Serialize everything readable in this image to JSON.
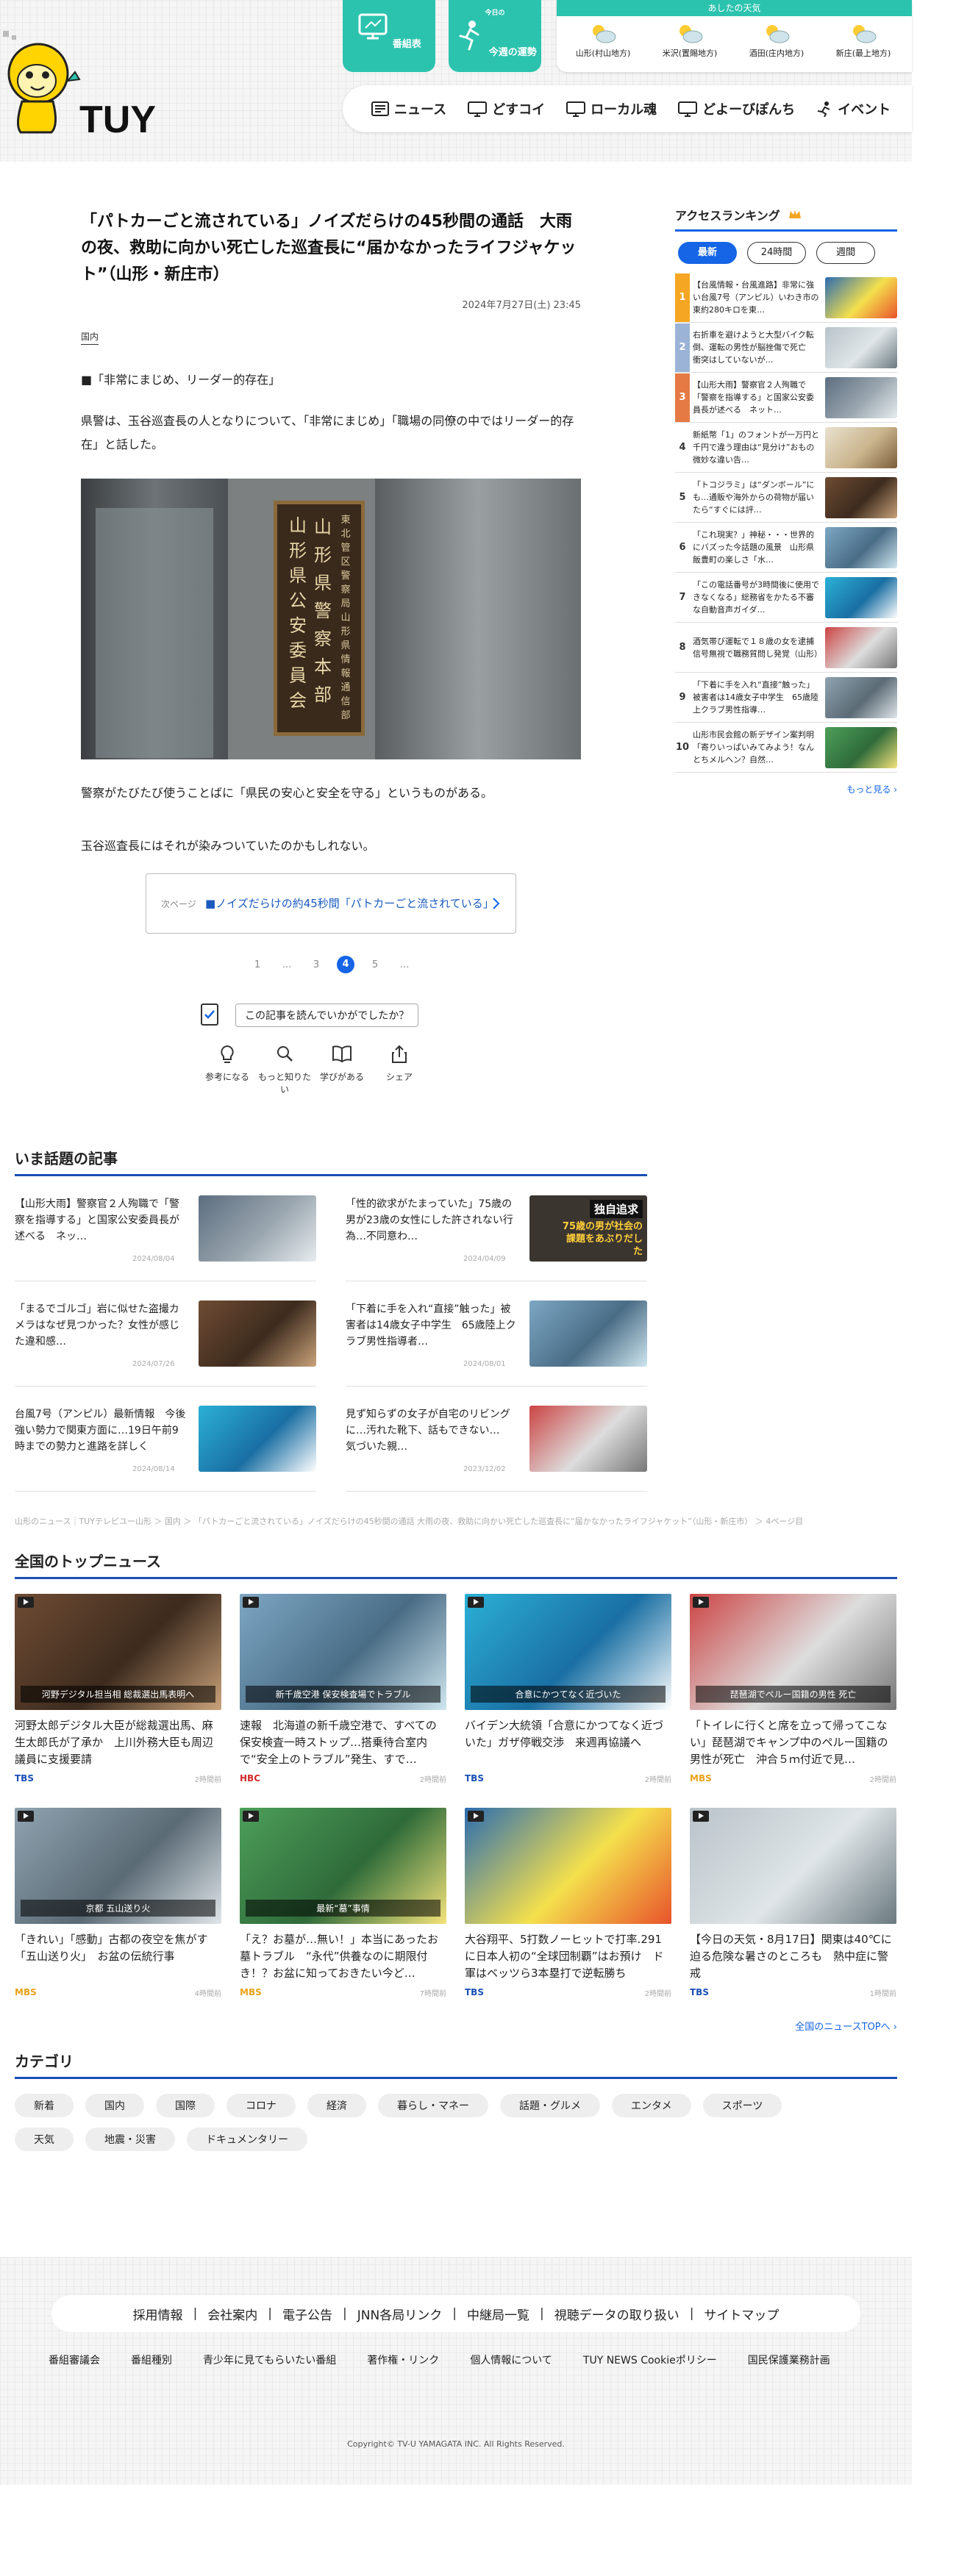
{
  "header": {
    "logo_text": "TUY",
    "btn_program": "番組表",
    "btn_fortune_small": "今日の",
    "btn_fortune": "今週の運勢",
    "weather_title": "あしたの天気",
    "weather": [
      {
        "area": "山形(村山地方)",
        "icon": "partly-sunny-icon"
      },
      {
        "area": "米沢(置賜地方)",
        "icon": "partly-sunny-icon"
      },
      {
        "area": "酒田(庄内地方)",
        "icon": "partly-sunny-icon"
      },
      {
        "area": "新庄(最上地方)",
        "icon": "partly-sunny-icon"
      }
    ],
    "nav": [
      "ニュース",
      "どすコイ",
      "ローカル魂",
      "どよーびぽんち",
      "イベント"
    ]
  },
  "article": {
    "title": "「パトカーごと流されている」ノイズだらけの45秒間の通話　大雨の夜、救助に向かい死亡した巡査長に“届かなかったライフジャケット”（山形・新庄市）",
    "date": "2024年7月27日(土) 23:45",
    "category": "国内",
    "subhead": "■「非常にまじめ、リーダー的存在」",
    "para1": "県警は、玉谷巡査長の人となりについて、「非常にまじめ」「職場の同僚の中ではリーダー的存在」と話した。",
    "sign_left": "山形県公安委員会",
    "sign_right": "山形県警察本部",
    "sign_small": "東北管区警察局山形県情報通信部",
    "para2": "警察がたびたび使うことばに「県民の安心と安全を守る」というものがある。",
    "para3": "玉谷巡査長にはそれが染みついていたのかもしれない。",
    "next_label": "次ページ",
    "next_title": "■ノイズだらけの約45秒間「パトカーごと流されている」",
    "pages": [
      "1",
      "…",
      "3",
      "4",
      "5",
      "…"
    ],
    "current_page": "4",
    "feedback_q": "この記事を読んでいかがでしたか？",
    "feedback_opts": [
      "参考になる",
      "もっと知りたい",
      "学びがある",
      "シェア"
    ]
  },
  "ranking": {
    "title": "アクセスランキング",
    "tabs": [
      "最新",
      "24時間",
      "週間"
    ],
    "items": [
      {
        "no": "1",
        "text": "【台風情報・台風進路】非常に強い台風7号（アンピル）いわき市の東約280キロを東…",
        "color": "#f5a623"
      },
      {
        "no": "2",
        "text": "右折車を避けようと大型バイク転倒、運転の男性が脳挫傷で死亡　衝突はしていないが…",
        "color": "#9ab3d6"
      },
      {
        "no": "3",
        "text": "【山形大雨】警察官２人殉職で「警察を指導する」と国家公安委員長が述べる　ネット…",
        "color": "#e57a44"
      },
      {
        "no": "4",
        "text": "新紙幣「1」のフォントが一万円と千円で違う理由は“見分け”おもの微妙な違い告…",
        "color": ""
      },
      {
        "no": "5",
        "text": "「トコジラミ」は“ダンボール”にも…通販や海外からの荷物が届いたら“すぐには評…",
        "color": ""
      },
      {
        "no": "6",
        "text": "「これ現実？」神秘・・・世界的にバズった今話題の風景　山形県飯豊町の楽しさ「水…",
        "color": ""
      },
      {
        "no": "7",
        "text": "「この電話番号が3時間後に使用できなくなる」総務省をかたる不審な自動音声ガイダ…",
        "color": ""
      },
      {
        "no": "8",
        "text": "酒気帯び運転で１８歳の女を逮捕　信号無視で職務質問し発覚（山形）",
        "color": ""
      },
      {
        "no": "9",
        "text": "「下着に手を入れ“直接”触った」被害者は14歳女子中学生　65歳陸上クラブ男性指導…",
        "color": ""
      },
      {
        "no": "10",
        "text": "山形市民会館の新デザイン案判明「寄りいっぱいみてみよう！なんとちメルヘン？自然…",
        "color": ""
      }
    ],
    "more": "もっと見る"
  },
  "trending": {
    "title": "いま話題の記事",
    "items": [
      {
        "text": "【山形大雨】警察官２人殉職で「警察を指導する」と国家公安委員長が述べる　ネッ…",
        "date": "2024/08/04"
      },
      {
        "text": "「性的欲求がたまっていた」75歳の男が23歳の女性にした許されない行為…不同意わ…",
        "date": "2024/04/09",
        "badge": "独自追求",
        "badge2": "75歳の男が社会の課題をあぶりだした"
      },
      {
        "text": "「まるでゴルゴ」岩に似せた盗撮カメラはなぜ見つかった？女性が感じた違和感…",
        "date": "2024/07/26"
      },
      {
        "text": "「下着に手を入れ“直接”触った」被害者は14歳女子中学生　65歳陸上クラブ男性指導者…",
        "date": "2024/08/01"
      },
      {
        "text": "台風7号（アンピル）最新情報　今後強い勢力で関東方面に…19日午前9時までの勢力と進路を詳しく",
        "date": "2024/08/14"
      },
      {
        "text": "見ず知らずの女子が自宅のリビングに…汚れた靴下、話もできない…　気づいた親…",
        "date": "2023/12/02"
      }
    ]
  },
  "breadcrumb": "山形のニュース｜TUYテレビユー山形 ＞ 国内 ＞ 「パトカーごと流されている」ノイズだらけの45秒間の通話 大雨の夜、救助に向かい死亡した巡査長に“届かなかったライフジャケット”（山形・新庄市） ＞ 4ページ目",
  "national": {
    "title": "全国のトップニュース",
    "items": [
      {
        "text": "河野太郎デジタル大臣が総裁選出馬、麻生太郎氏が了承か　上川外務大臣も周辺議員に支援要請",
        "src": "TBS",
        "src_color": "#1a4fb5",
        "time": "2時間前",
        "cap": "河野デジタル担当相 総裁選出馬表明へ"
      },
      {
        "text": "速報　北海道の新千歳空港で、すべての保安検査一時ストップ…搭乗待合室内で“安全上のトラブル”発生、すで…",
        "src": "HBC",
        "src_color": "#d12a2a",
        "time": "2時間前",
        "cap": "新千歳空港 保安検査場でトラブル"
      },
      {
        "text": "バイデン大統領「合意にかつてなく近づいた」ガザ停戦交渉　来週再協議へ",
        "src": "TBS",
        "src_color": "#1a4fb5",
        "time": "2時間前",
        "cap": "合意にかつてなく近づいた"
      },
      {
        "text": "「トイレに行くと席を立って帰ってこない」琵琶湖でキャンプ中のペルー国籍の男性が死亡　沖合５ｍ付近で見…",
        "src": "MBS",
        "src_color": "#e8a21a",
        "time": "2時間前",
        "cap": "琵琶湖でペルー国籍の男性 死亡"
      },
      {
        "text": "「きれい」「感動」古都の夜空を焦がす「五山送り火」　お盆の伝統行事",
        "src": "MBS",
        "src_color": "#e8a21a",
        "time": "4時間前",
        "cap": "京都 五山送り火"
      },
      {
        "text": "「え？お墓が…無い！」本当にあったお墓トラブル　“永代”供養なのに期限付き！？お盆に知っておきたい今ど…",
        "src": "MBS",
        "src_color": "#e8a21a",
        "time": "7時間前",
        "cap": "最新“墓”事情"
      },
      {
        "text": "大谷翔平、5打数ノーヒットで打率.291に日本人初の“全球団制覇”はお預け　ド軍はベッツら3本塁打で逆転勝ち",
        "src": "TBS",
        "src_color": "#1a4fb5",
        "time": "2時間前",
        "cap": ""
      },
      {
        "text": "【今日の天気・8月17日】関東は40℃に迫る危険な暑さのところも　熱中症に警戒",
        "src": "TBS",
        "src_color": "#1a4fb5",
        "time": "1時間前",
        "cap": ""
      }
    ],
    "more": "全国のニュースTOPへ"
  },
  "categories": {
    "title": "カテゴリ",
    "items": [
      "新着",
      "国内",
      "国際",
      "コロナ",
      "経済",
      "暮らし・マネー",
      "話題・グルメ",
      "エンタメ",
      "スポーツ",
      "天気",
      "地震・災害",
      "ドキュメンタリー"
    ]
  },
  "footer": {
    "links": [
      "採用情報",
      "会社案内",
      "電子公告",
      "JNN各局リンク",
      "中継局一覧",
      "視聴データの取り扱い",
      "サイトマップ"
    ],
    "links2": [
      "番組審議会",
      "番組種別",
      "青少年に見てもらいたい番組",
      "著作権・リンク",
      "個人情報について",
      "TUY NEWS Cookieポリシー",
      "国民保護業務計画"
    ],
    "copyright": "Copyright© TV-U YAMAGATA INC. All Rights Reserved."
  }
}
